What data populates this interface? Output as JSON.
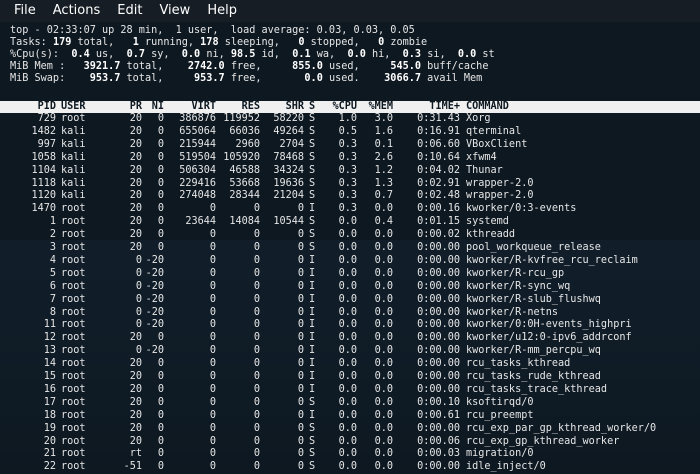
{
  "menu": [
    "File",
    "Actions",
    "Edit",
    "View",
    "Help"
  ],
  "summary": {
    "l1": [
      {
        "t": "top - 02:33:07 up 28 min,  1 user,  load average: 0.03, 0.03, 0.05",
        "b": false
      }
    ],
    "l2": [
      {
        "t": "Tasks: ",
        "b": false
      },
      {
        "t": "179",
        "b": true
      },
      {
        "t": " total,   ",
        "b": false
      },
      {
        "t": "1",
        "b": true
      },
      {
        "t": " running, ",
        "b": false
      },
      {
        "t": "178",
        "b": true
      },
      {
        "t": " sleeping,   ",
        "b": false
      },
      {
        "t": "0",
        "b": true
      },
      {
        "t": " stopped,   ",
        "b": false
      },
      {
        "t": "0",
        "b": true
      },
      {
        "t": " zombie",
        "b": false
      }
    ],
    "l3": [
      {
        "t": "%Cpu(s):  ",
        "b": false
      },
      {
        "t": "0.4",
        "b": true
      },
      {
        "t": " us,  ",
        "b": false
      },
      {
        "t": "0.7",
        "b": true
      },
      {
        "t": " sy,  ",
        "b": false
      },
      {
        "t": "0.0",
        "b": true
      },
      {
        "t": " ni, ",
        "b": false
      },
      {
        "t": "98.5",
        "b": true
      },
      {
        "t": " id,  ",
        "b": false
      },
      {
        "t": "0.1",
        "b": true
      },
      {
        "t": " wa,  ",
        "b": false
      },
      {
        "t": "0.0",
        "b": true
      },
      {
        "t": " hi,  ",
        "b": false
      },
      {
        "t": "0.3",
        "b": true
      },
      {
        "t": " si,  ",
        "b": false
      },
      {
        "t": "0.0",
        "b": true
      },
      {
        "t": " st",
        "b": false
      }
    ],
    "l4": [
      {
        "t": "MiB Mem :   ",
        "b": false
      },
      {
        "t": "3921.7",
        "b": true
      },
      {
        "t": " total,    ",
        "b": false
      },
      {
        "t": "2742.0",
        "b": true
      },
      {
        "t": " free,     ",
        "b": false
      },
      {
        "t": "855.0",
        "b": true
      },
      {
        "t": " used,     ",
        "b": false
      },
      {
        "t": "545.0",
        "b": true
      },
      {
        "t": " buff/cache",
        "b": false
      }
    ],
    "l5": [
      {
        "t": "MiB Swap:    ",
        "b": false
      },
      {
        "t": "953.7",
        "b": true
      },
      {
        "t": " total,     ",
        "b": false
      },
      {
        "t": "953.7",
        "b": true
      },
      {
        "t": " free,       ",
        "b": false
      },
      {
        "t": "0.0",
        "b": true
      },
      {
        "t": " used.    ",
        "b": false
      },
      {
        "t": "3066.7",
        "b": true
      },
      {
        "t": " avail Mem",
        "b": false
      }
    ]
  },
  "columns": [
    "PID",
    "USER",
    "PR",
    "NI",
    "VIRT",
    "RES",
    "SHR",
    "S",
    "%CPU",
    "%MEM",
    "TIME+",
    "COMMAND"
  ],
  "processes": [
    [
      "729",
      "root",
      "20",
      "0",
      "386876",
      "119952",
      "58220",
      "S",
      "1.0",
      "3.0",
      "0:31.43",
      "Xorg"
    ],
    [
      "1482",
      "kali",
      "20",
      "0",
      "655064",
      "66036",
      "49264",
      "S",
      "0.5",
      "1.6",
      "0:16.91",
      "qterminal"
    ],
    [
      "997",
      "kali",
      "20",
      "0",
      "215944",
      "2960",
      "2704",
      "S",
      "0.3",
      "0.1",
      "0:06.60",
      "VBoxClient"
    ],
    [
      "1058",
      "kali",
      "20",
      "0",
      "519504",
      "105920",
      "78468",
      "S",
      "0.3",
      "2.6",
      "0:10.64",
      "xfwm4"
    ],
    [
      "1104",
      "kali",
      "20",
      "0",
      "506304",
      "46588",
      "34324",
      "S",
      "0.3",
      "1.2",
      "0:04.02",
      "Thunar"
    ],
    [
      "1118",
      "kali",
      "20",
      "0",
      "229416",
      "53668",
      "19636",
      "S",
      "0.3",
      "1.3",
      "0:02.91",
      "wrapper-2.0"
    ],
    [
      "1120",
      "kali",
      "20",
      "0",
      "274048",
      "28344",
      "21204",
      "S",
      "0.3",
      "0.7",
      "0:02.48",
      "wrapper-2.0"
    ],
    [
      "1470",
      "root",
      "20",
      "0",
      "0",
      "0",
      "0",
      "I",
      "0.3",
      "0.0",
      "0:00.16",
      "kworker/0:3-events"
    ],
    [
      "1",
      "root",
      "20",
      "0",
      "23644",
      "14084",
      "10544",
      "S",
      "0.0",
      "0.4",
      "0:01.15",
      "systemd"
    ],
    [
      "2",
      "root",
      "20",
      "0",
      "0",
      "0",
      "0",
      "S",
      "0.0",
      "0.0",
      "0:00.02",
      "kthreadd"
    ],
    [
      "3",
      "root",
      "20",
      "0",
      "0",
      "0",
      "0",
      "S",
      "0.0",
      "0.0",
      "0:00.00",
      "pool_workqueue_release"
    ],
    [
      "4",
      "root",
      "0",
      "-20",
      "0",
      "0",
      "0",
      "I",
      "0.0",
      "0.0",
      "0:00.00",
      "kworker/R-kvfree_rcu_reclaim"
    ],
    [
      "5",
      "root",
      "0",
      "-20",
      "0",
      "0",
      "0",
      "I",
      "0.0",
      "0.0",
      "0:00.00",
      "kworker/R-rcu_gp"
    ],
    [
      "6",
      "root",
      "0",
      "-20",
      "0",
      "0",
      "0",
      "I",
      "0.0",
      "0.0",
      "0:00.00",
      "kworker/R-sync_wq"
    ],
    [
      "7",
      "root",
      "0",
      "-20",
      "0",
      "0",
      "0",
      "I",
      "0.0",
      "0.0",
      "0:00.00",
      "kworker/R-slub_flushwq"
    ],
    [
      "8",
      "root",
      "0",
      "-20",
      "0",
      "0",
      "0",
      "I",
      "0.0",
      "0.0",
      "0:00.00",
      "kworker/R-netns"
    ],
    [
      "11",
      "root",
      "0",
      "-20",
      "0",
      "0",
      "0",
      "I",
      "0.0",
      "0.0",
      "0:00.00",
      "kworker/0:0H-events_highpri"
    ],
    [
      "12",
      "root",
      "20",
      "0",
      "0",
      "0",
      "0",
      "I",
      "0.0",
      "0.0",
      "0:00.00",
      "kworker/u12:0-ipv6_addrconf"
    ],
    [
      "13",
      "root",
      "0",
      "-20",
      "0",
      "0",
      "0",
      "I",
      "0.0",
      "0.0",
      "0:00.00",
      "kworker/R-mm_percpu_wq"
    ],
    [
      "14",
      "root",
      "20",
      "0",
      "0",
      "0",
      "0",
      "I",
      "0.0",
      "0.0",
      "0:00.00",
      "rcu_tasks_kthread"
    ],
    [
      "15",
      "root",
      "20",
      "0",
      "0",
      "0",
      "0",
      "I",
      "0.0",
      "0.0",
      "0:00.00",
      "rcu_tasks_rude_kthread"
    ],
    [
      "16",
      "root",
      "20",
      "0",
      "0",
      "0",
      "0",
      "I",
      "0.0",
      "0.0",
      "0:00.00",
      "rcu_tasks_trace_kthread"
    ],
    [
      "17",
      "root",
      "20",
      "0",
      "0",
      "0",
      "0",
      "S",
      "0.0",
      "0.0",
      "0:00.10",
      "ksoftirqd/0"
    ],
    [
      "18",
      "root",
      "20",
      "0",
      "0",
      "0",
      "0",
      "I",
      "0.0",
      "0.0",
      "0:00.61",
      "rcu_preempt"
    ],
    [
      "19",
      "root",
      "20",
      "0",
      "0",
      "0",
      "0",
      "S",
      "0.0",
      "0.0",
      "0:00.00",
      "rcu_exp_par_gp_kthread_worker/0"
    ],
    [
      "20",
      "root",
      "20",
      "0",
      "0",
      "0",
      "0",
      "S",
      "0.0",
      "0.0",
      "0:00.06",
      "rcu_exp_gp_kthread_worker"
    ],
    [
      "21",
      "root",
      "rt",
      "0",
      "0",
      "0",
      "0",
      "S",
      "0.0",
      "0.0",
      "0:00.03",
      "migration/0"
    ],
    [
      "22",
      "root",
      "-51",
      "0",
      "0",
      "0",
      "0",
      "S",
      "0.0",
      "0.0",
      "0:00.00",
      "idle_inject/0"
    ]
  ]
}
